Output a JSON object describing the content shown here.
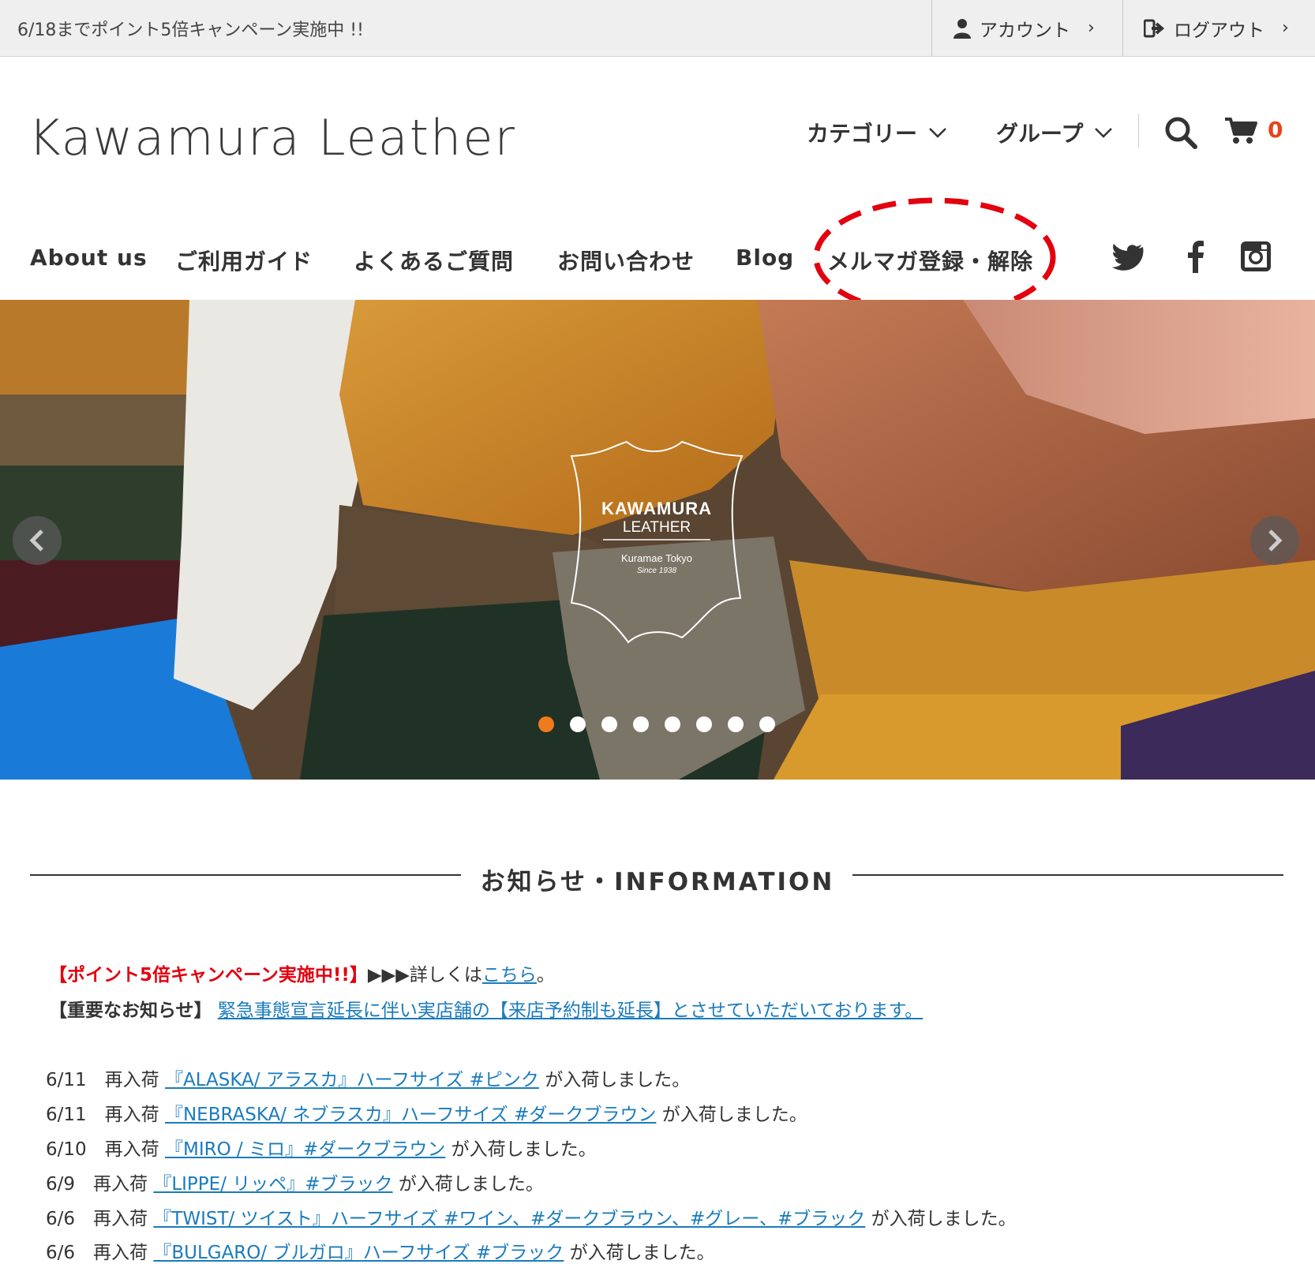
{
  "topbar": {
    "promo": "6/18までポイント5倍キャンペーン実施中 !!",
    "account_label": "アカウント",
    "logout_label": "ログアウト"
  },
  "header": {
    "logo": "Kawamura Leather",
    "category_label": "カテゴリー",
    "group_label": "グループ",
    "cart_count": "0"
  },
  "nav": {
    "items": [
      "About us",
      "ご利用ガイド",
      "よくあるご質問",
      "お問い合わせ",
      "Blog",
      "メルマガ登録・解除"
    ],
    "social": [
      "twitter-icon",
      "facebook-icon",
      "instagram-icon"
    ]
  },
  "hero": {
    "logo_line1": "KAWAMURA",
    "logo_line2": "LEATHER",
    "logo_line3": "Kuramae Tokyo",
    "logo_line4": "Since 1938",
    "slide_count": 8,
    "active_slide": 1
  },
  "info": {
    "title": "お知らせ・INFORMATION",
    "campaign_tag": "【ポイント5倍キャンペーン実施中!!】",
    "campaign_text": "▶▶▶詳しくは",
    "campaign_link": "こちら",
    "campaign_end": "。",
    "important_tag": "【重要なお知らせ】",
    "important_link": "緊急事態宣言延長に伴い実店舗の【来店予約制も延長】とさせていただいております。",
    "news": [
      {
        "date": "6/11",
        "type": "再入荷",
        "link": "『ALASKA/ アラスカ』ハーフサイズ #ピンク",
        "suffix": "が入荷しました。"
      },
      {
        "date": "6/11",
        "type": "再入荷",
        "link": "『NEBRASKA/ ネブラスカ』ハーフサイズ #ダークブラウン",
        "suffix": "が入荷しました。"
      },
      {
        "date": "6/10",
        "type": "再入荷",
        "link": "『MIRO / ミロ』#ダークブラウン",
        "suffix": "が入荷しました。"
      },
      {
        "date": "6/9",
        "type": "再入荷",
        "link": "『LIPPE/ リッペ』#ブラック",
        "suffix": "が入荷しました。"
      },
      {
        "date": "6/6",
        "type": "再入荷",
        "link": "『TWIST/ ツイスト』ハーフサイズ #ワイン、#ダークブラウン、#グレー、#ブラック",
        "suffix": "が入荷しました。"
      },
      {
        "date": "6/6",
        "type": "再入荷",
        "link": "『BULGARO/ ブルガロ』ハーフサイズ #ブラック",
        "suffix": "が入荷しました。"
      }
    ]
  },
  "colors": {
    "accent_orange": "#f07a1e",
    "cart_red": "#e8431a",
    "link_blue": "#1a7bbd",
    "annotation_red": "#e3000f"
  }
}
